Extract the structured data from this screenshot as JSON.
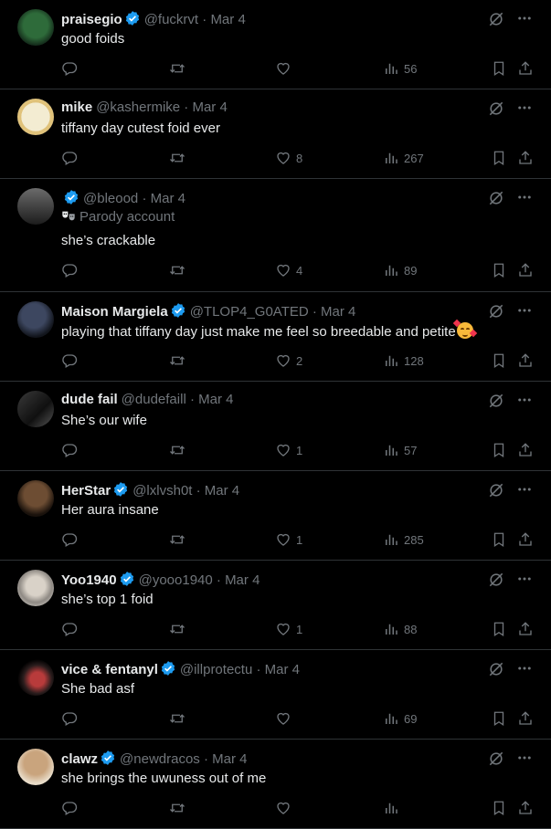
{
  "colors": {
    "accent": "#1d9bf0",
    "muted": "#71767b",
    "divider": "#2f3336",
    "background": "#000000",
    "text": "#e7e9ea"
  },
  "icons": [
    "verified-badge-icon",
    "grok-icon",
    "more-icon",
    "reply-icon",
    "retweet-icon",
    "like-icon",
    "views-icon",
    "bookmark-icon",
    "share-icon",
    "parody-mask-icon"
  ],
  "tweets": [
    {
      "name": "praisegio",
      "verified": true,
      "handle": "@fuckrvt",
      "date": "Mar 4",
      "text": "good foids",
      "replies": "",
      "retweets": "",
      "likes": "",
      "views": "56"
    },
    {
      "name": "mike",
      "verified": false,
      "handle": "@kashermike",
      "date": "Mar 4",
      "text": "tiffany day cutest foid ever",
      "replies": "",
      "retweets": "",
      "likes": "8",
      "views": "267"
    },
    {
      "name": "",
      "verified": true,
      "handle": "@bleood",
      "date": "Mar 4",
      "parody": "Parody account",
      "text": "she’s crackable",
      "replies": "",
      "retweets": "",
      "likes": "4",
      "views": "89"
    },
    {
      "name": "Maison Margiela",
      "verified": true,
      "handle": "@TLOP4_G0ATED",
      "date": "Mar 4",
      "text": "playing that tiffany day just make me feel so breedable and petite",
      "replies": "",
      "retweets": "",
      "likes": "2",
      "views": "128"
    },
    {
      "name": "dude fail",
      "verified": false,
      "handle": "@dudefaill",
      "date": "Mar 4",
      "text": "She’s our wife",
      "replies": "",
      "retweets": "",
      "likes": "1",
      "views": "57"
    },
    {
      "name": "HerStar",
      "verified": true,
      "handle": "@lxlvsh0t",
      "date": "Mar 4",
      "text": "Her aura insane",
      "replies": "",
      "retweets": "",
      "likes": "1",
      "views": "285"
    },
    {
      "name": "Yoo1940",
      "verified": true,
      "handle": "@yooo1940",
      "date": "Mar 4",
      "text": "she’s top 1 foid",
      "replies": "",
      "retweets": "",
      "likes": "1",
      "views": "88"
    },
    {
      "name": "vice & fentanyl",
      "verified": true,
      "handle": "@illprotectu",
      "date": "Mar 4",
      "text": "She bad asf",
      "replies": "",
      "retweets": "",
      "likes": "",
      "views": "69"
    },
    {
      "name": "clawz",
      "verified": true,
      "handle": "@newdracos",
      "date": "Mar 4",
      "text": "she brings the uwuness out of me",
      "replies": "",
      "retweets": "",
      "likes": "",
      "views": ""
    }
  ]
}
